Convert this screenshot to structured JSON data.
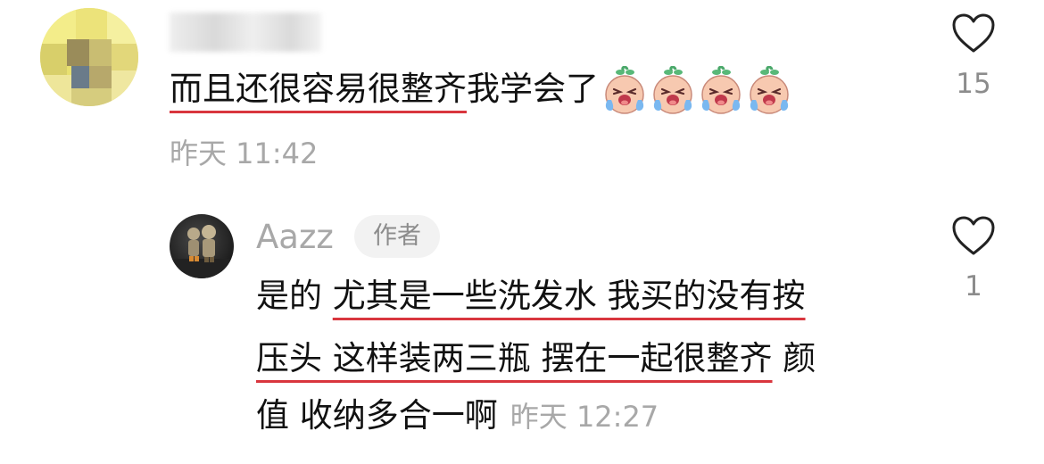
{
  "comment": {
    "username": "",
    "text_underlined": "而且还很容易很整齐",
    "text_rest": " 我学会了",
    "emoji_name": "crying-face-sticker",
    "emoji_count": 4,
    "time": "昨天 11:42",
    "likes": "15"
  },
  "reply": {
    "username": "Aazz",
    "badge": "作者",
    "line1_plain": "是的 ",
    "line1_underlined": "尤其是一些洗发水 我买的没有按",
    "line2_underlined": "压头 这样装两三瓶 摆在一起很整齐",
    "line2_plain": " 颜",
    "line3_plain": "值 收纳多合一啊",
    "time": "昨天 12:27",
    "likes": "1"
  },
  "icons": {
    "like": "heart-outline-icon"
  },
  "colors": {
    "text": "#111111",
    "muted": "#a8a8a8",
    "underline": "#d9363e",
    "badge_bg": "#f2f2f2"
  }
}
